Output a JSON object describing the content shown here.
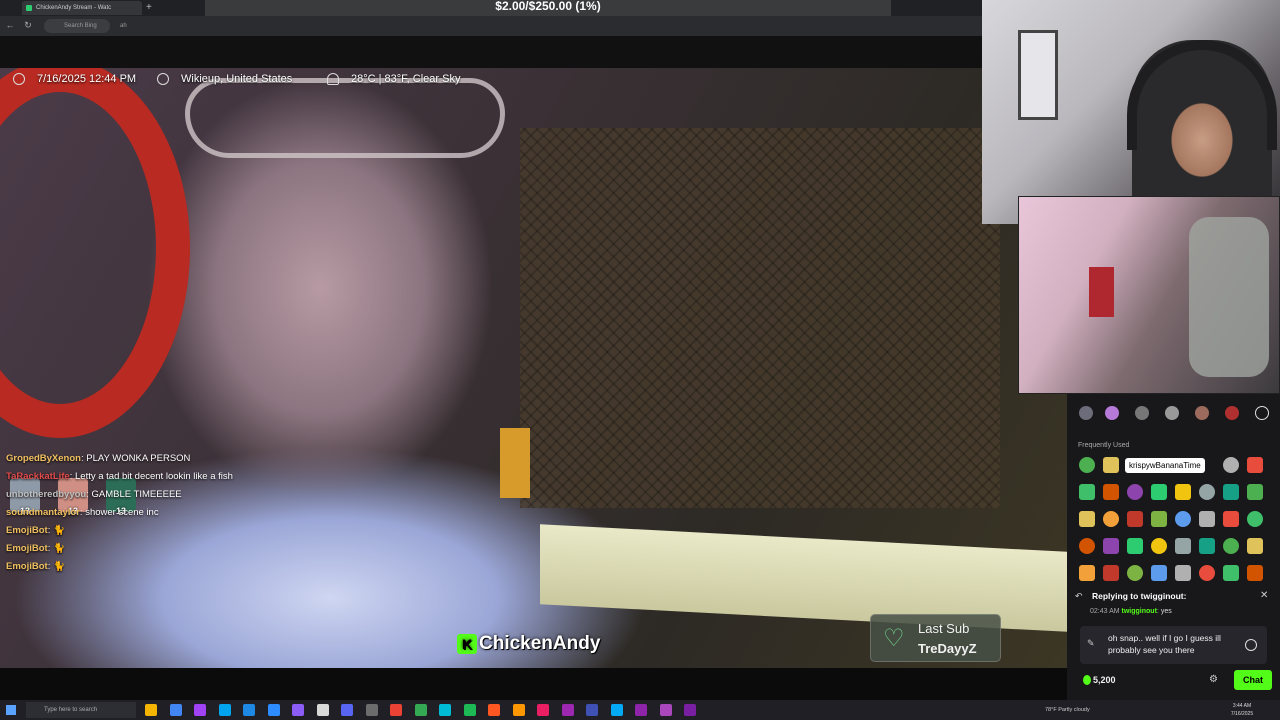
{
  "browser": {
    "tab_title": "ChickenAndy Stream - Watc",
    "new_tab": "+",
    "goal_text": "$2.00/$250.00 (1%)",
    "search_placeholder": "Search Bing",
    "address_text": "ah"
  },
  "overlay": {
    "datetime": "7/16/2025 12:44 PM",
    "location": "Wikieup, United States",
    "weather": "28°C | 83°F, Clear Sky",
    "badge_count": "13",
    "streamer_name": "ChickenAndy",
    "kick_glyph": "K",
    "last_sub_title": "Last Sub",
    "last_sub_name": "TreDayyZ"
  },
  "stream_chat": [
    {
      "user": "GropedByXenon",
      "message": "PLAY WONKA PERSON"
    },
    {
      "user": "TaRackkatLife",
      "message": "Letty a tad bit decent lookin like a fish"
    },
    {
      "user": "unbotheredbyyou",
      "message": "GAMBLE TIMEEEEE"
    },
    {
      "user": "soundmantaylor",
      "message": "shower scene inc"
    },
    {
      "user": "EmojiBot",
      "message": "🐈"
    },
    {
      "user": "EmojiBot",
      "message": "🐈"
    },
    {
      "user": "EmojiBot",
      "message": "🐈"
    }
  ],
  "emote_panel": {
    "frequently_used_label": "Frequently Used",
    "tooltip": "krispywBananaTime"
  },
  "reply": {
    "replying_to": "Replying to twigginout:",
    "time": "02:43 AM",
    "user": "twigginout",
    "message": "yes"
  },
  "chat_input": {
    "value": "oh snap.. well if I go I guess ill probably see you there"
  },
  "footer": {
    "points": "5,200",
    "chat_button": "Chat"
  },
  "taskbar": {
    "search_placeholder": "Type here to search",
    "weather": "78°F  Partly cloudy",
    "time": "3:44 AM",
    "date": "7/16/2025"
  },
  "colors": {
    "kick_green": "#53fc18",
    "panel_bg": "#18181b"
  }
}
